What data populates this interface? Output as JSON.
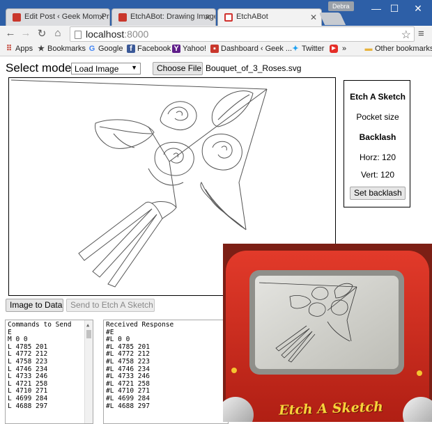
{
  "browser": {
    "tabs": [
      {
        "title": "Edit Post ‹ Geek Mom Pro",
        "active": false
      },
      {
        "title": "EtchABot: Drawing Images",
        "active": false
      },
      {
        "title": "EtchABot",
        "active": true
      }
    ],
    "profile_name": "Debra",
    "url_host": "localhost",
    "url_port": ":8000"
  },
  "bookmarks": [
    {
      "label": "Apps",
      "icon": "apps-grid-icon"
    },
    {
      "label": "Bookmarks",
      "icon": "star-icon"
    },
    {
      "label": "Google",
      "icon": "google-icon"
    },
    {
      "label": "Facebook",
      "icon": "facebook-icon"
    },
    {
      "label": "Yahoo!",
      "icon": "yahoo-icon"
    },
    {
      "label": "Dashboard ‹ Geek ...",
      "icon": "dashboard-icon"
    },
    {
      "label": "Twitter",
      "icon": "twitter-icon"
    },
    {
      "label": "",
      "icon": "youtube-icon"
    }
  ],
  "bookmarks_overflow": "»",
  "bookmarks_other": "Other bookmarks",
  "page": {
    "select_label": "Select mode:",
    "mode_value": "Load Image",
    "choose_file": "Choose File",
    "file_name": "Bouquet_of_3_Roses.svg",
    "image_to_data": "Image to Data",
    "send_button": "Send to Etch A Sketch"
  },
  "settings": {
    "title": "Etch A Sketch",
    "size": "Pocket size",
    "backlash_title": "Backlash",
    "horz": "Horz: 120",
    "vert": "Vert: 120",
    "set_backlash": "Set backlash"
  },
  "commands": {
    "header": "Commands to Send",
    "lines": [
      "E",
      "M 0 0",
      "L 4785 201",
      "L 4772 212",
      "L 4758 223",
      "L 4746 234",
      "L 4733 246",
      "L 4721 258",
      "L 4710 271",
      "L 4699 284",
      "L 4688 297"
    ]
  },
  "responses": {
    "header": "Received Response",
    "lines": [
      "#E",
      "#L 0 0",
      "#L 4785 201",
      "#L 4772 212",
      "#L 4758 223",
      "#L 4746 234",
      "#L 4733 246",
      "#L 4721 258",
      "#L 4710 271",
      "#L 4699 284",
      "#L 4688 297"
    ]
  },
  "photo": {
    "brand": "Etch A Sketch"
  },
  "colors": {
    "titlebar": "#2d5fa7",
    "toy_red": "#c8281c",
    "screen_gray": "#cfcfca"
  }
}
